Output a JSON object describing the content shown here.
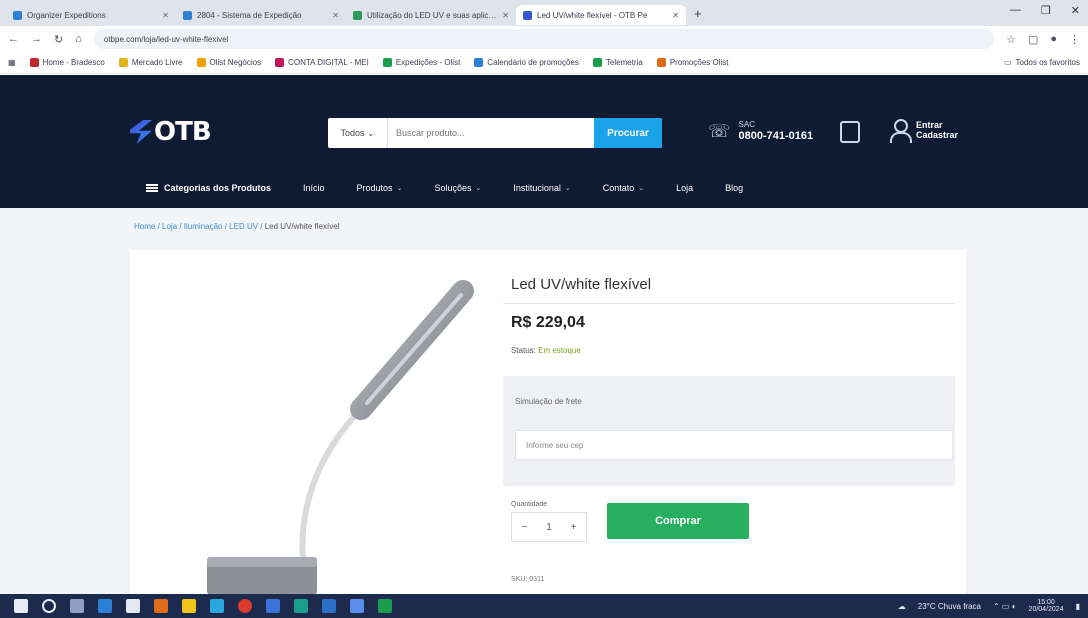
{
  "browser": {
    "tabs": [
      {
        "title": "Organizer Expeditions",
        "color": "#2d7fd6"
      },
      {
        "title": "2804 - Sistema de Expedição",
        "color": "#2d7fd6"
      },
      {
        "title": "Utilização do LED UV e suas aplicações",
        "color": "#2a9b5b"
      },
      {
        "title": "Led UV/white flexível - OTB Pe",
        "color": "#3157d6"
      }
    ],
    "new_tab": "+",
    "url": "otbpe.com/loja/led-uv-white-flexivel",
    "bookmarks": [
      {
        "label": "Home - Bradesco",
        "color": "#c0262d"
      },
      {
        "label": "Mercado Livre",
        "color": "#e0b31a"
      },
      {
        "label": "Olist Negócios",
        "color": "#f0a000"
      },
      {
        "label": "CONTA DIGITAL - MEI",
        "color": "#c2185b"
      },
      {
        "label": "Expedições - Olist",
        "color": "#1b9e4b"
      },
      {
        "label": "Calendário de promoções",
        "color": "#2d7fd6"
      },
      {
        "label": "Telemetria",
        "color": "#1b9e4b"
      },
      {
        "label": "Promoções Olist",
        "color": "#e06b1a"
      }
    ],
    "bookmarks_all": "Todos os favoritos"
  },
  "header": {
    "logo": "OTB",
    "search_category": "Todos ⌄",
    "search_placeholder": "Buscar produto...",
    "search_button": "Procurar",
    "phone_label": "SAC",
    "phone_number": "0800-741-0161",
    "account_line1": "Entrar",
    "account_line2": "Cadastrar"
  },
  "nav": {
    "all_categories": "Categorias dos Produtos",
    "items": [
      {
        "label": "Início",
        "dropdown": false
      },
      {
        "label": "Produtos",
        "dropdown": true
      },
      {
        "label": "Soluções",
        "dropdown": true
      },
      {
        "label": "Institucional",
        "dropdown": true
      },
      {
        "label": "Contato",
        "dropdown": true
      },
      {
        "label": "Loja",
        "dropdown": false
      },
      {
        "label": "Blog",
        "dropdown": false
      }
    ]
  },
  "breadcrumb": {
    "path": "Home / Loja / Iluminação / LED UV / ",
    "current": "Led UV/white flexível"
  },
  "product": {
    "title": "Led UV/white flexível",
    "price": "R$ 229,04",
    "status_label": "Status: ",
    "status_value": "Em estoque",
    "freight_label": "Simulação de frete",
    "freight_placeholder": "Informe seu cep",
    "qty_label": "Quantidade",
    "qty_minus": "−",
    "qty_value": "1",
    "qty_plus": "+",
    "buy_button": "Comprar",
    "sku": "SKU: 0311"
  },
  "taskbar": {
    "weather": "23°C Chuva fraca",
    "time": "15:00",
    "date": "20/04/2024"
  }
}
